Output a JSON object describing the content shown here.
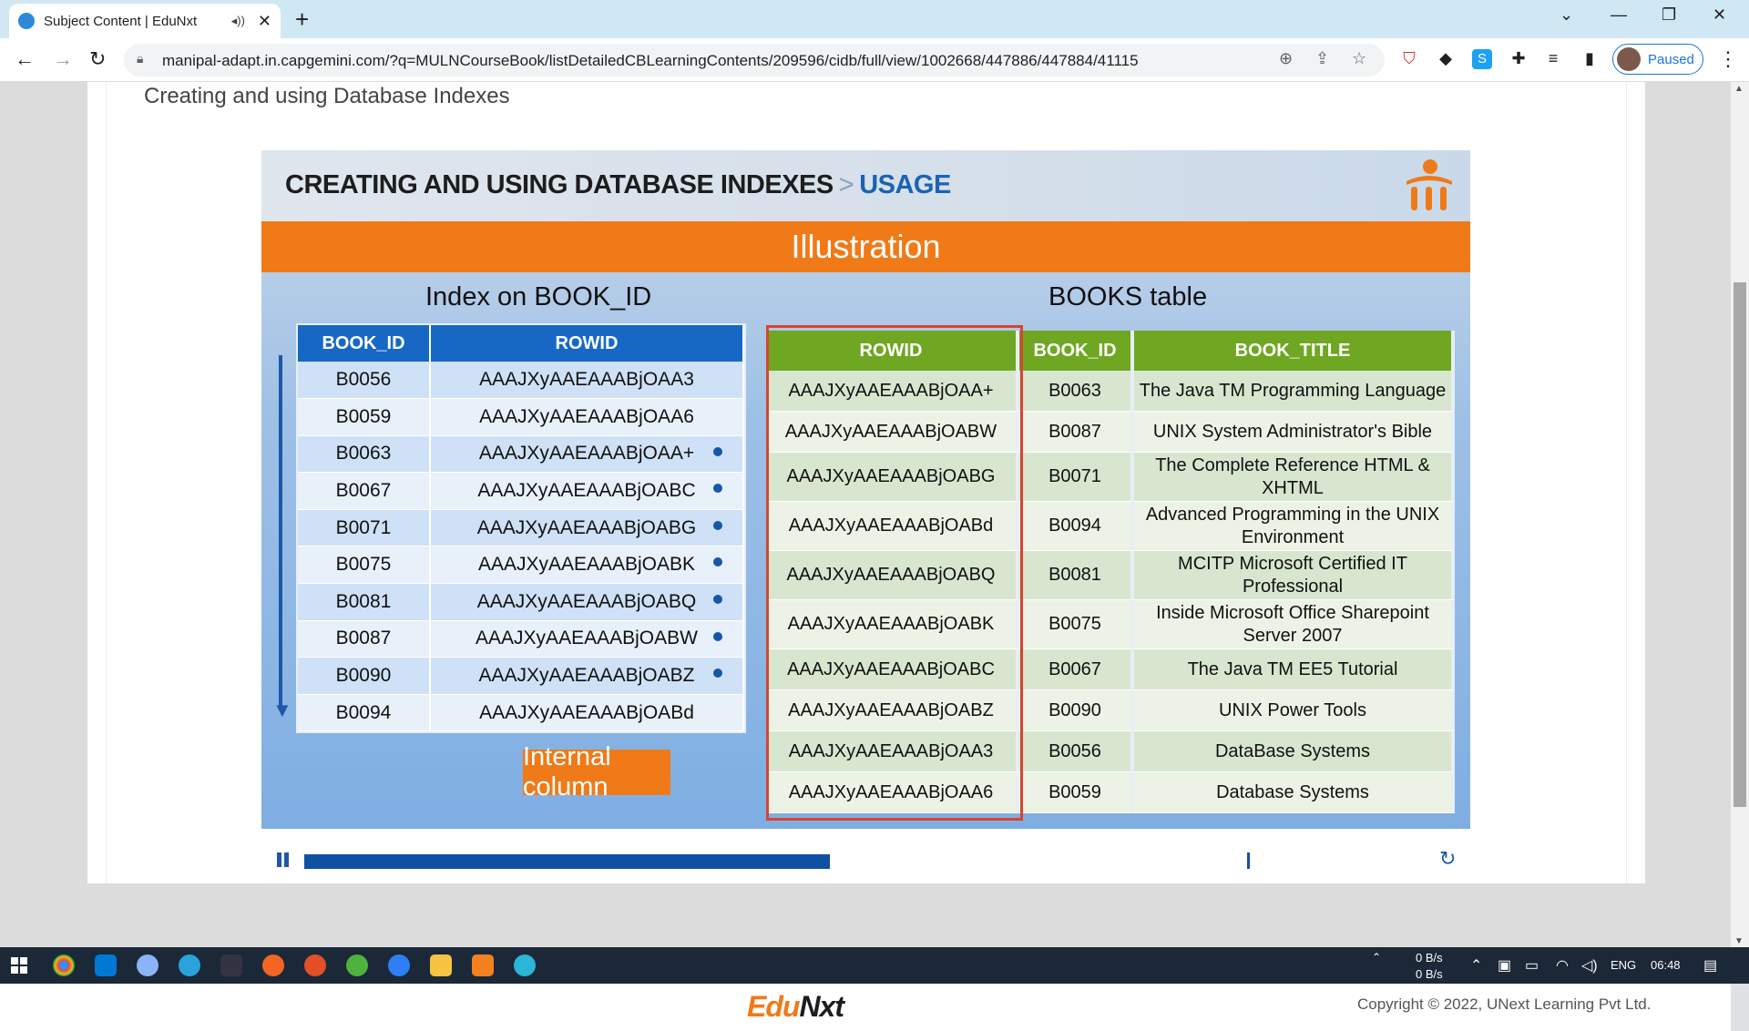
{
  "browser": {
    "tab_title": "Subject Content | EduNxt",
    "new_tab": "+",
    "url": "manipal-adapt.in.capgemini.com/?q=MULNCourseBook/listDetailedCBLearningContents/209596/cidb/full/view/1002668/447886/447884/41115",
    "profile_status": "Paused"
  },
  "page": {
    "heading": "Creating and using Database Indexes"
  },
  "slide": {
    "title_main": "CREATING AND USING DATABASE INDEXES",
    "title_sep": ">",
    "title_accent": "USAGE",
    "banner": "Illustration",
    "index_caption": "Index on BOOK_ID",
    "books_caption": "BOOKS table",
    "internal_column": "Internal column",
    "index_table": {
      "headers": [
        "BOOK_ID",
        "ROWID"
      ],
      "rows": [
        [
          "B0056",
          "AAAJXyAAEAAABjOAA3"
        ],
        [
          "B0059",
          "AAAJXyAAEAAABjOAA6"
        ],
        [
          "B0063",
          "AAAJXyAAEAAABjOAA+"
        ],
        [
          "B0067",
          "AAAJXyAAEAAABjOABC"
        ],
        [
          "B0071",
          "AAAJXyAAEAAABjOABG"
        ],
        [
          "B0075",
          "AAAJXyAAEAAABjOABK"
        ],
        [
          "B0081",
          "AAAJXyAAEAAABjOABQ"
        ],
        [
          "B0087",
          "AAAJXyAAEAAABjOABW"
        ],
        [
          "B0090",
          "AAAJXyAAEAAABjOABZ"
        ],
        [
          "B0094",
          "AAAJXyAAEAAABjOABd"
        ]
      ]
    },
    "books_table": {
      "headers": [
        "ROWID",
        "BOOK_ID",
        "BOOK_TITLE"
      ],
      "rows": [
        [
          "AAAJXyAAEAAABjOAA+",
          "B0063",
          "The Java TM Programming Language"
        ],
        [
          "AAAJXyAAEAAABjOABW",
          "B0087",
          "UNIX System Administrator's Bible"
        ],
        [
          "AAAJXyAAEAAABjOABG",
          "B0071",
          "The Complete Reference HTML & XHTML"
        ],
        [
          "AAAJXyAAEAAABjOABd",
          "B0094",
          "Advanced Programming in the UNIX Environment"
        ],
        [
          "AAAJXyAAEAAABjOABQ",
          "B0081",
          "MCITP  Microsoft Certified IT Professional"
        ],
        [
          "AAAJXyAAEAAABjOABK",
          "B0075",
          "Inside Microsoft  Office Sharepoint Server 2007"
        ],
        [
          "AAAJXyAAEAAABjOABC",
          "B0067",
          "The Java TM EE5 Tutorial"
        ],
        [
          "AAAJXyAAEAAABjOABZ",
          "B0090",
          "UNIX Power Tools"
        ],
        [
          "AAAJXyAAEAAABjOAA3",
          "B0056",
          "DataBase Systems"
        ],
        [
          "AAAJXyAAEAAABjOAA6",
          "B0059",
          "Database Systems"
        ]
      ]
    }
  },
  "player": {
    "progress_fraction": 0.555,
    "marker_fraction": 0.995
  },
  "footer": {
    "logo_edu": "Edu",
    "logo_nxt": "Nxt",
    "copyright": "Copyright © 2022, UNext Learning Pvt Ltd."
  },
  "taskbar": {
    "net_up": "0 B/s",
    "net_down": "0 B/s",
    "language": "ENG",
    "time": "06:48"
  },
  "colors": {
    "index_header": "#1768c4",
    "books_header": "#6fa722",
    "banner": "#f07a18",
    "accent_title": "#1a63b3",
    "rowid_highlight": "#d9442e"
  }
}
